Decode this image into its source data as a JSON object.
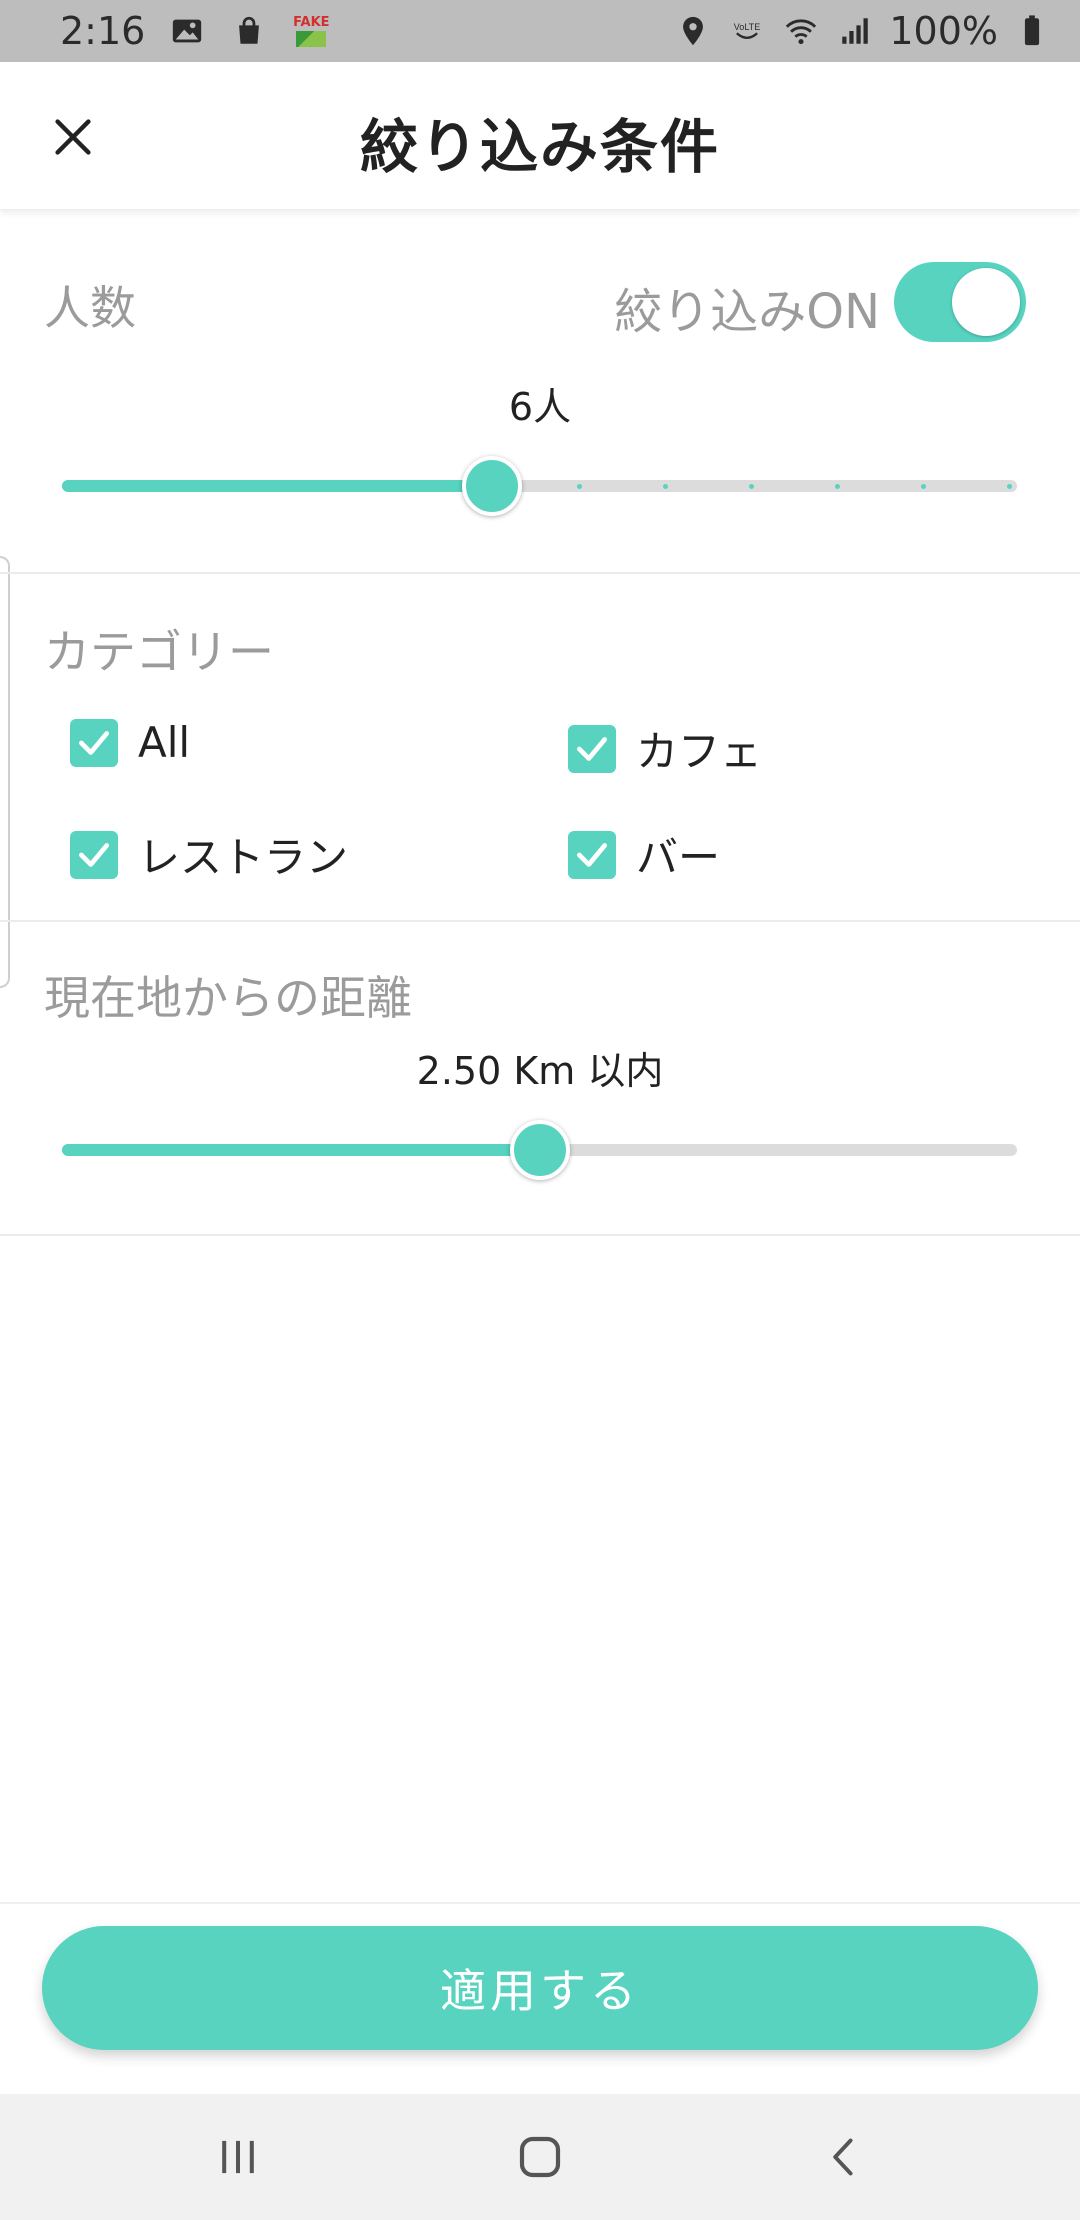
{
  "status_bar": {
    "time": "2:16",
    "battery": "100%",
    "fake_label": "FAKE",
    "icons": [
      "image-icon",
      "shopping-bag-icon",
      "fake-gps-icon",
      "location-icon",
      "volte-icon",
      "wifi-icon",
      "signal-icon",
      "battery-icon"
    ]
  },
  "header": {
    "title": "絞り込み条件",
    "close_icon": "close-icon"
  },
  "people": {
    "label": "人数",
    "toggle_label": "絞り込みON",
    "toggle_on": true,
    "value_text": "6人",
    "slider_fraction": 0.45
  },
  "category": {
    "label": "カテゴリー",
    "items": [
      {
        "label": "All",
        "checked": true
      },
      {
        "label": "カフェ",
        "checked": true
      },
      {
        "label": "レストラン",
        "checked": true
      },
      {
        "label": "バー",
        "checked": true
      }
    ]
  },
  "distance": {
    "label": "現在地からの距離",
    "value_text": "2.50 Km 以内",
    "slider_fraction": 0.5
  },
  "apply_button": {
    "label": "適用する"
  },
  "nav_bar": {
    "icons": [
      "recents-icon",
      "home-icon",
      "back-icon"
    ]
  },
  "colors": {
    "accent": "#57d3c0",
    "status_bar": "#bdbdbd",
    "label_gray": "#9b9b9b",
    "track": "#dcdcdc"
  }
}
